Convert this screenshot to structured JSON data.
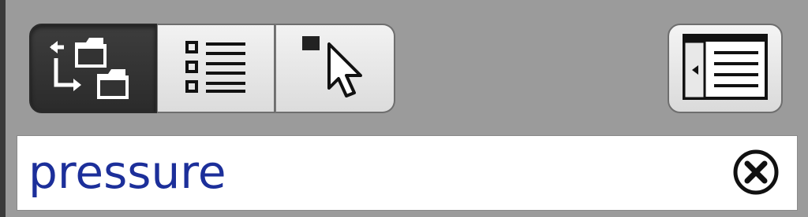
{
  "toolbar": {
    "view_modes": [
      {
        "icon": "hierarchy-tree-icon",
        "active": true
      },
      {
        "icon": "list-view-icon",
        "active": false
      },
      {
        "icon": "pointer-select-icon",
        "active": false
      }
    ],
    "side_panel_icon": "side-panel-toggle-icon"
  },
  "search": {
    "value": "pressure",
    "placeholder": "",
    "clear_icon": "clear-circle-x-icon"
  },
  "colors": {
    "toolbar_bg": "#9b9b9b",
    "active_segment": "#333333",
    "input_text": "#1c2f9a"
  }
}
